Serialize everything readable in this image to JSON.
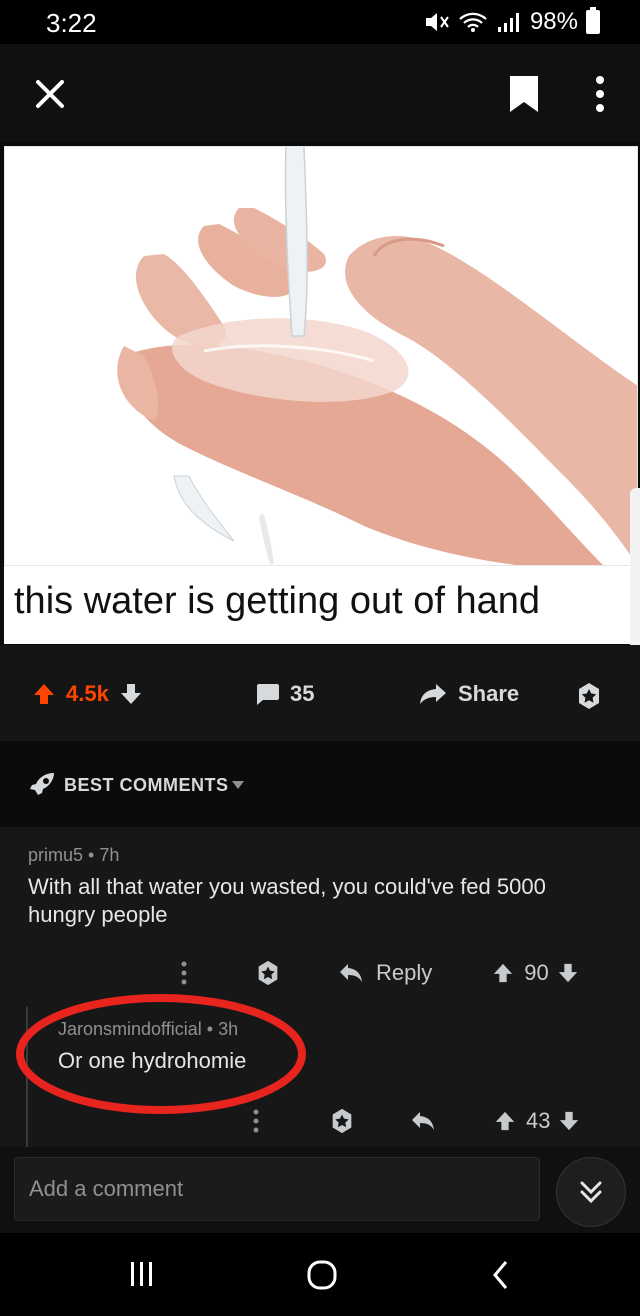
{
  "status_bar": {
    "time": "3:22",
    "battery": "98%"
  },
  "post": {
    "caption": "this water is getting out of hand",
    "score": "4.5k",
    "comment_count": "35",
    "share_label": "Share"
  },
  "sort": {
    "label": "BEST COMMENTS"
  },
  "comments": [
    {
      "author": "primu5",
      "age": "7h",
      "body": "With all that water you wasted, you could've fed 5000 hungry people",
      "reply_label": "Reply",
      "score": "90"
    },
    {
      "author": "Jaronsmindofficial",
      "age": "3h",
      "body": "Or one hydrohomie",
      "score": "43"
    }
  ],
  "composer": {
    "placeholder": "Add a comment"
  },
  "colors": {
    "upvote": "#ff4500",
    "annotation": "#e8241f",
    "background": "#0b0b0b"
  },
  "icons": [
    "close-icon",
    "bookmark-icon",
    "more-icon",
    "upvote-icon",
    "downvote-icon",
    "comment-icon",
    "share-icon",
    "award-icon",
    "rocket-icon",
    "reply-icon",
    "chevron-double-down-icon",
    "recents-icon",
    "home-icon",
    "back-icon"
  ]
}
